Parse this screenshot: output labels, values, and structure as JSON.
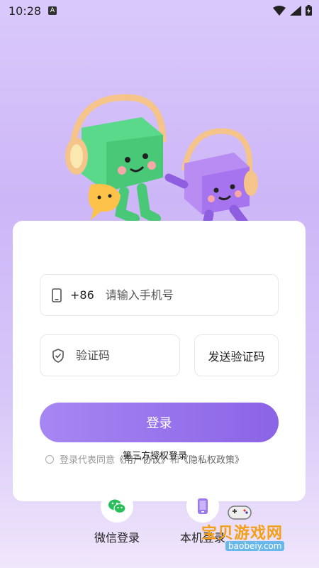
{
  "status_bar": {
    "time": "10:28",
    "a_badge": "A"
  },
  "login": {
    "country_code": "+86",
    "phone_placeholder": "请输入手机号",
    "code_placeholder": "验证码",
    "send_code_label": "发送验证码",
    "login_label": "登录",
    "agreement_text": "登录代表同意",
    "user_agreement": "《用户协议》",
    "and_text": "和",
    "privacy_policy": "《隐私权政策》",
    "third_party_title": "第三方授权登录"
  },
  "bottom_options": {
    "wechat_label": "微信登录",
    "local_label": "本机登录"
  },
  "watermark": {
    "text": "宝贝游戏网",
    "url": "baobeiy.com"
  },
  "colors": {
    "primary": "#8b63e6",
    "accent_green": "#2bbf5b"
  },
  "icons": [
    "phone-icon",
    "shield-icon",
    "wechat-icon",
    "mobile-icon",
    "wifi-icon",
    "signal-icon",
    "battery-icon"
  ]
}
